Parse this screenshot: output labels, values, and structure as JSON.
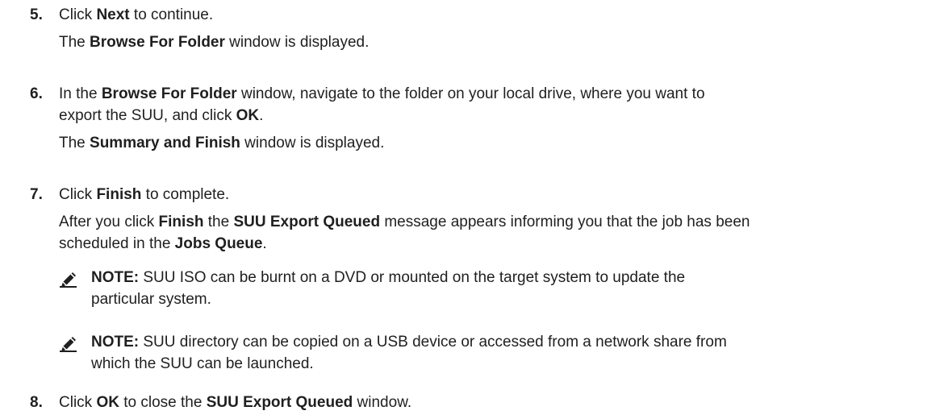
{
  "steps": [
    {
      "number": "5.",
      "action": {
        "pre": "Click ",
        "b1": "Next",
        "post": " to continue."
      },
      "result": {
        "pre": "The ",
        "b1": "Browse For Folder",
        "post": " window is displayed."
      }
    },
    {
      "number": "6.",
      "action_line1": {
        "pre": "In the ",
        "b1": "Browse For Folder",
        "post": " window, navigate to the folder on your local drive, where you want to"
      },
      "action_line2": {
        "pre": "export the SUU, and click ",
        "b1": "OK",
        "post": "."
      },
      "result": {
        "pre": "The ",
        "b1": "Summary and Finish",
        "post": " window is displayed."
      }
    },
    {
      "number": "7.",
      "action": {
        "pre": "Click ",
        "b1": "Finish",
        "post": " to complete."
      },
      "result_line1": {
        "pre": "After you click ",
        "b1": "Finish",
        "mid": " the ",
        "b2": "SUU Export Queued",
        "post": " message appears informing you that the job has been"
      },
      "result_line2": {
        "pre": "scheduled in the ",
        "b1": "Jobs Queue",
        "post": "."
      },
      "notes": [
        {
          "label": "NOTE:",
          "line1": " SUU ISO can be burnt on a DVD or mounted on the target system to update the",
          "line2": "particular system."
        },
        {
          "label": "NOTE:",
          "line1": " SUU directory can be copied on a USB device or accessed from a network share from",
          "line2": "which the SUU can be launched."
        }
      ]
    },
    {
      "number": "8.",
      "action": {
        "pre": "Click ",
        "b1": "OK",
        "mid": " to close the ",
        "b2": "SUU Export Queued",
        "post": " window."
      }
    }
  ]
}
